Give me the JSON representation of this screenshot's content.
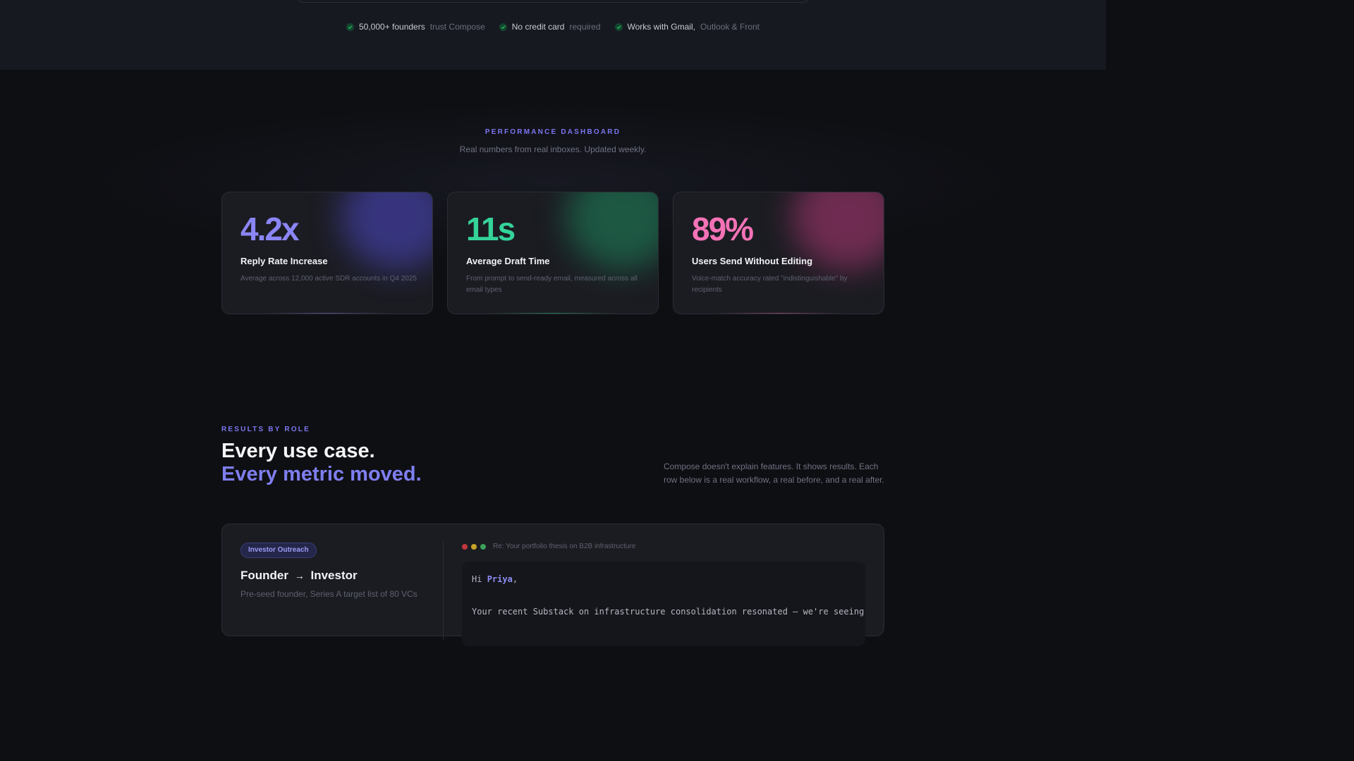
{
  "trust_bar": {
    "items": [
      {
        "strong": "50,000+ founders",
        "muted": "trust Compose"
      },
      {
        "strong": "No credit card",
        "muted": "required"
      },
      {
        "strong": "Works with Gmail,",
        "muted": "Outlook & Front"
      }
    ],
    "check_color": "#22c55e"
  },
  "dashboard": {
    "eyebrow": "PERFORMANCE DASHBOARD",
    "subtitle": "Real numbers from real inboxes. Updated weekly.",
    "cards": [
      {
        "value": "4.2x",
        "title": "Reply Rate Increase",
        "description": "Average across 12,000 active SDR accounts in Q4 2025",
        "accent": "#8b86f5"
      },
      {
        "value": "11s",
        "title": "Average Draft Time",
        "description": "From prompt to send-ready email, measured across all email types",
        "accent": "#34d399"
      },
      {
        "value": "89%",
        "title": "Users Send Without Editing",
        "description": "Voice-match accuracy rated \"indistinguishable\" by recipients",
        "accent": "#f472b6"
      }
    ]
  },
  "results": {
    "eyebrow": "RESULTS BY ROLE",
    "heading_line1": "Every use case.",
    "heading_line2": "Every metric moved.",
    "description": "Compose doesn't explain features. It shows results. Each row below is a real workflow, a real before, and a real after."
  },
  "case": {
    "tag": "Investor Outreach",
    "from": "Founder",
    "arrow": "→",
    "to": "Investor",
    "subtitle": "Pre-seed founder, Series A target list of 80 VCs",
    "window_dots": [
      "#c2383f",
      "#c7a327",
      "#3aa05a"
    ],
    "email_subject": "Re: Your portfolio thesis on B2B infrastructure",
    "greeting": "Hi",
    "recipient": "Priya",
    "greeting_punct": ",",
    "first_line": "Your recent Substack on infrastructure consolidation resonated — we're seeing"
  }
}
